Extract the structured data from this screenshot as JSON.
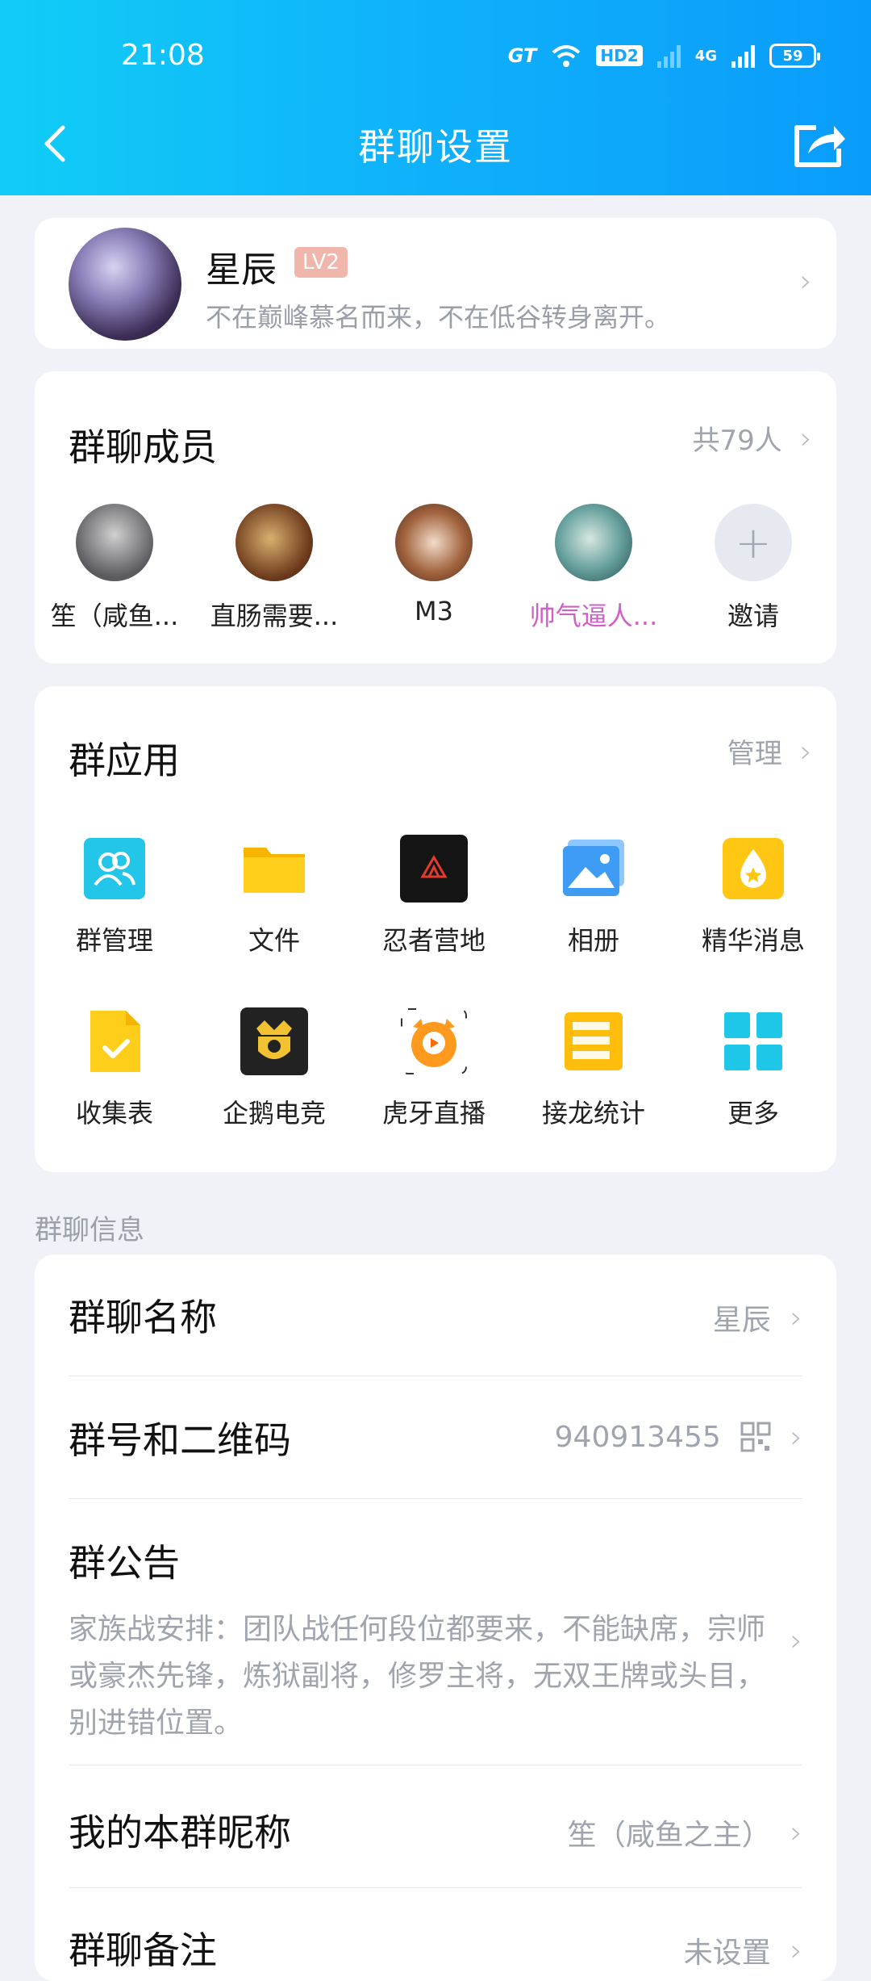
{
  "status_bar": {
    "time": "21:08",
    "network": "4G",
    "carrier_tag": "GT",
    "hd": "HD2",
    "battery": "59"
  },
  "nav": {
    "title": "群聊设置"
  },
  "profile": {
    "name": "星辰",
    "level": "LV2",
    "signature": "不在巅峰慕名而来，不在低谷转身离开。"
  },
  "members": {
    "title": "群聊成员",
    "count_text": "共79人",
    "items": [
      {
        "name": "笙（咸鱼...",
        "highlight": false
      },
      {
        "name": "直肠需要...",
        "highlight": false
      },
      {
        "name": "M3",
        "highlight": false
      },
      {
        "name": "帅气逼人...",
        "highlight": true
      }
    ],
    "invite_label": "邀请"
  },
  "apps": {
    "title": "群应用",
    "manage_label": "管理",
    "items": [
      {
        "label": "群管理",
        "icon": "group-manage-icon"
      },
      {
        "label": "文件",
        "icon": "folder-icon"
      },
      {
        "label": "忍者营地",
        "icon": "ninja-camp-icon"
      },
      {
        "label": "相册",
        "icon": "album-icon"
      },
      {
        "label": "精华消息",
        "icon": "essence-icon"
      },
      {
        "label": "收集表",
        "icon": "form-icon"
      },
      {
        "label": "企鹅电竞",
        "icon": "esports-icon"
      },
      {
        "label": "虎牙直播",
        "icon": "huya-icon"
      },
      {
        "label": "接龙统计",
        "icon": "solitaire-icon"
      },
      {
        "label": "更多",
        "icon": "more-grid-icon"
      }
    ]
  },
  "info": {
    "section_label": "群聊信息",
    "group_name": {
      "label": "群聊名称",
      "value": "星辰"
    },
    "group_id": {
      "label": "群号和二维码",
      "value": "940913455"
    },
    "notice": {
      "label": "群公告",
      "text": "家族战安排：团队战任何段位都要来，不能缺席，宗师或豪杰先锋，炼狱副将，修罗主将，无双王牌或头目，别进错位置。"
    },
    "nickname": {
      "label": "我的本群昵称",
      "value": "笙（咸鱼之主）"
    },
    "remark": {
      "label": "群聊备注",
      "value": "未设置"
    }
  },
  "colors": {
    "header_start": "#10cdf6",
    "header_end": "#0a9cfb",
    "background": "#f1f2f7",
    "level_badge": "#f1b6ab",
    "highlight_name": "#d060c8"
  }
}
